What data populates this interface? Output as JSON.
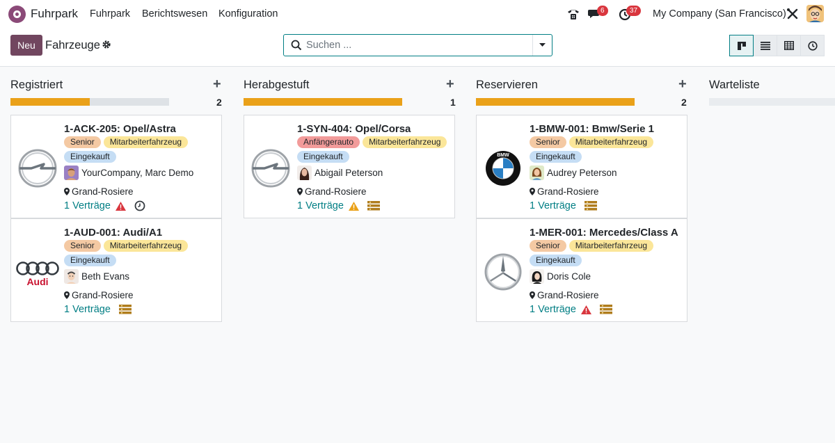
{
  "navbar": {
    "app_name": "Fuhrpark",
    "menu": [
      "Fuhrpark",
      "Berichtswesen",
      "Konfiguration"
    ],
    "messages_badge": "6",
    "activities_badge": "37",
    "company": "My Company (San Francisco)"
  },
  "control": {
    "new_label": "Neu",
    "breadcrumb": "Fahrzeuge",
    "search_placeholder": "Suchen ..."
  },
  "colors": {
    "accent": "#017e84",
    "primary": "#71465f",
    "progress": "#eaa119"
  },
  "columns": [
    {
      "title": "Registriert",
      "count": "2",
      "progress_fraction": 0.5
    },
    {
      "title": "Herabgestuft",
      "count": "1",
      "progress_fraction": 1.0
    },
    {
      "title": "Reservieren",
      "count": "2",
      "progress_fraction": 1.0
    },
    {
      "title": "Warteliste",
      "count": "",
      "progress_fraction": 0.0
    }
  ],
  "cards": [
    {
      "title": "1-ACK-205: Opel/Astra",
      "tags": [
        "Senior",
        "Mitarbeiterfahrzeug",
        "Eingekauft"
      ],
      "driver": "YourCompany, Marc Demo",
      "location": "Grand-Rosiere",
      "contracts": "1 Verträge",
      "brand": "opel",
      "status_icons": [
        "warning-red-icon",
        "clock-icon"
      ]
    },
    {
      "title": "1-AUD-001: Audi/A1",
      "tags": [
        "Senior",
        "Mitarbeiterfahrzeug",
        "Eingekauft"
      ],
      "driver": "Beth Evans",
      "location": "Grand-Rosiere",
      "contracts": "1 Verträge",
      "brand": "audi",
      "brand_text": "Audi",
      "status_icons": [
        "contract-stack-icon"
      ]
    },
    {
      "title": "1-SYN-404: Opel/Corsa",
      "tags": [
        "Anfängerauto",
        "Mitarbeiterfahrzeug",
        "Eingekauft"
      ],
      "driver": "Abigail Peterson",
      "location": "Grand-Rosiere",
      "contracts": "1 Verträge",
      "brand": "opel",
      "status_icons": [
        "warning-orange-icon",
        "contract-stack-icon"
      ]
    },
    {
      "title": "1-BMW-001: Bmw/Serie 1",
      "tags": [
        "Senior",
        "Mitarbeiterfahrzeug",
        "Eingekauft"
      ],
      "driver": "Audrey Peterson",
      "location": "Grand-Rosiere",
      "contracts": "1 Verträge",
      "brand": "bmw",
      "brand_text": "BMW",
      "status_icons": [
        "contract-stack-icon"
      ]
    },
    {
      "title": "1-MER-001: Mercedes/Class A",
      "tags": [
        "Senior",
        "Mitarbeiterfahrzeug",
        "Eingekauft"
      ],
      "driver": "Doris Cole",
      "location": "Grand-Rosiere",
      "contracts": "1 Verträge",
      "brand": "mercedes",
      "status_icons": [
        "warning-red-icon",
        "contract-stack-icon"
      ]
    }
  ]
}
